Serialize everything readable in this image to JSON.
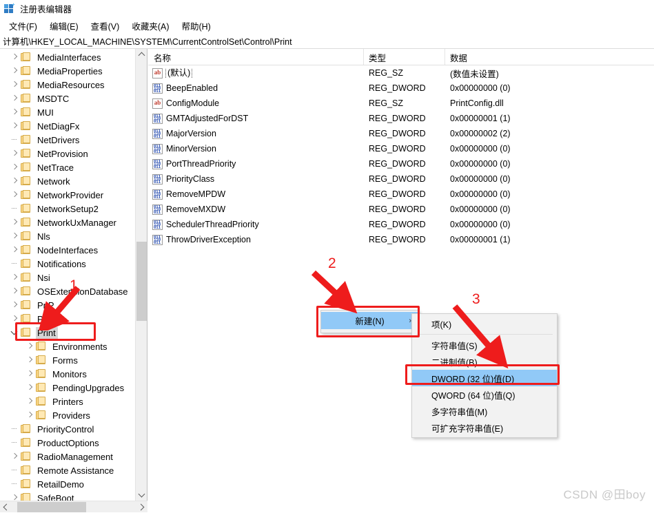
{
  "window": {
    "title": "注册表编辑器",
    "icon": "registry-editor-icon"
  },
  "menubar": {
    "items": [
      {
        "label": "文件(F)"
      },
      {
        "label": "编辑(E)"
      },
      {
        "label": "查看(V)"
      },
      {
        "label": "收藏夹(A)"
      },
      {
        "label": "帮助(H)"
      }
    ]
  },
  "address": {
    "path": "计算机\\HKEY_LOCAL_MACHINE\\SYSTEM\\CurrentControlSet\\Control\\Print"
  },
  "tree": {
    "items": [
      {
        "label": "MediaInterfaces",
        "depth": 1,
        "state": "collapsed",
        "selected": false
      },
      {
        "label": "MediaProperties",
        "depth": 1,
        "state": "collapsed",
        "selected": false
      },
      {
        "label": "MediaResources",
        "depth": 1,
        "state": "collapsed",
        "selected": false
      },
      {
        "label": "MSDTC",
        "depth": 1,
        "state": "collapsed",
        "selected": false
      },
      {
        "label": "MUI",
        "depth": 1,
        "state": "collapsed",
        "selected": false
      },
      {
        "label": "NetDiagFx",
        "depth": 1,
        "state": "collapsed",
        "selected": false
      },
      {
        "label": "NetDrivers",
        "depth": 1,
        "state": "leaf",
        "selected": false
      },
      {
        "label": "NetProvision",
        "depth": 1,
        "state": "collapsed",
        "selected": false
      },
      {
        "label": "NetTrace",
        "depth": 1,
        "state": "collapsed",
        "selected": false
      },
      {
        "label": "Network",
        "depth": 1,
        "state": "collapsed",
        "selected": false
      },
      {
        "label": "NetworkProvider",
        "depth": 1,
        "state": "collapsed",
        "selected": false
      },
      {
        "label": "NetworkSetup2",
        "depth": 1,
        "state": "leaf",
        "selected": false
      },
      {
        "label": "NetworkUxManager",
        "depth": 1,
        "state": "collapsed",
        "selected": false
      },
      {
        "label": "Nls",
        "depth": 1,
        "state": "collapsed",
        "selected": false
      },
      {
        "label": "NodeInterfaces",
        "depth": 1,
        "state": "collapsed",
        "selected": false
      },
      {
        "label": "Notifications",
        "depth": 1,
        "state": "leaf",
        "selected": false
      },
      {
        "label": "Nsi",
        "depth": 1,
        "state": "collapsed",
        "selected": false
      },
      {
        "label": "OSExtensionDatabase",
        "depth": 1,
        "state": "collapsed",
        "selected": false
      },
      {
        "label": "PnP",
        "depth": 1,
        "state": "collapsed",
        "selected": false
      },
      {
        "label": "Power",
        "depth": 1,
        "state": "collapsed",
        "selected": false
      },
      {
        "label": "Print",
        "depth": 1,
        "state": "expanded",
        "selected": true
      },
      {
        "label": "Environments",
        "depth": 2,
        "state": "collapsed",
        "selected": false
      },
      {
        "label": "Forms",
        "depth": 2,
        "state": "collapsed",
        "selected": false
      },
      {
        "label": "Monitors",
        "depth": 2,
        "state": "collapsed",
        "selected": false
      },
      {
        "label": "PendingUpgrades",
        "depth": 2,
        "state": "collapsed",
        "selected": false
      },
      {
        "label": "Printers",
        "depth": 2,
        "state": "collapsed",
        "selected": false
      },
      {
        "label": "Providers",
        "depth": 2,
        "state": "collapsed",
        "selected": false
      },
      {
        "label": "PriorityControl",
        "depth": 1,
        "state": "leaf",
        "selected": false
      },
      {
        "label": "ProductOptions",
        "depth": 1,
        "state": "leaf",
        "selected": false
      },
      {
        "label": "RadioManagement",
        "depth": 1,
        "state": "collapsed",
        "selected": false
      },
      {
        "label": "Remote Assistance",
        "depth": 1,
        "state": "leaf",
        "selected": false
      },
      {
        "label": "RetailDemo",
        "depth": 1,
        "state": "leaf",
        "selected": false
      },
      {
        "label": "SafeBoot",
        "depth": 1,
        "state": "collapsed",
        "selected": false
      }
    ]
  },
  "list": {
    "columns": [
      {
        "label": "名称"
      },
      {
        "label": "类型"
      },
      {
        "label": "数据"
      }
    ],
    "rows": [
      {
        "name": "(默认)",
        "icon": "string-value-icon",
        "type": "REG_SZ",
        "data": "(数值未设置)",
        "focused": true
      },
      {
        "name": "BeepEnabled",
        "icon": "dword-value-icon",
        "type": "REG_DWORD",
        "data": "0x00000000 (0)",
        "focused": false
      },
      {
        "name": "ConfigModule",
        "icon": "string-value-icon",
        "type": "REG_SZ",
        "data": "PrintConfig.dll",
        "focused": false
      },
      {
        "name": "GMTAdjustedForDST",
        "icon": "dword-value-icon",
        "type": "REG_DWORD",
        "data": "0x00000001 (1)",
        "focused": false
      },
      {
        "name": "MajorVersion",
        "icon": "dword-value-icon",
        "type": "REG_DWORD",
        "data": "0x00000002 (2)",
        "focused": false
      },
      {
        "name": "MinorVersion",
        "icon": "dword-value-icon",
        "type": "REG_DWORD",
        "data": "0x00000000 (0)",
        "focused": false
      },
      {
        "name": "PortThreadPriority",
        "icon": "dword-value-icon",
        "type": "REG_DWORD",
        "data": "0x00000000 (0)",
        "focused": false
      },
      {
        "name": "PriorityClass",
        "icon": "dword-value-icon",
        "type": "REG_DWORD",
        "data": "0x00000000 (0)",
        "focused": false
      },
      {
        "name": "RemoveMPDW",
        "icon": "dword-value-icon",
        "type": "REG_DWORD",
        "data": "0x00000000 (0)",
        "focused": false
      },
      {
        "name": "RemoveMXDW",
        "icon": "dword-value-icon",
        "type": "REG_DWORD",
        "data": "0x00000000 (0)",
        "focused": false
      },
      {
        "name": "SchedulerThreadPriority",
        "icon": "dword-value-icon",
        "type": "REG_DWORD",
        "data": "0x00000000 (0)",
        "focused": false
      },
      {
        "name": "ThrowDriverException",
        "icon": "dword-value-icon",
        "type": "REG_DWORD",
        "data": "0x00000001 (1)",
        "focused": false
      }
    ]
  },
  "context_menu": {
    "new_item": {
      "label": "新建(N)",
      "arrow": "›",
      "highlighted": true
    },
    "submenu": [
      {
        "label": "项(K)",
        "highlighted": false,
        "separator_after": true
      },
      {
        "label": "字符串值(S)",
        "highlighted": false,
        "separator_after": false
      },
      {
        "label": "二进制值(B)",
        "highlighted": false,
        "separator_after": false
      },
      {
        "label": "DWORD (32 位)值(D)",
        "highlighted": true,
        "separator_after": false
      },
      {
        "label": "QWORD (64 位)值(Q)",
        "highlighted": false,
        "separator_after": false
      },
      {
        "label": "多字符串值(M)",
        "highlighted": false,
        "separator_after": false
      },
      {
        "label": "可扩充字符串值(E)",
        "highlighted": false,
        "separator_after": false
      }
    ]
  },
  "annotations": {
    "color": "#ee1c1c",
    "steps": [
      {
        "number": "1",
        "target": "tree-item-print"
      },
      {
        "number": "2",
        "target": "context-menu-new"
      },
      {
        "number": "3",
        "target": "context-menu-dword-32"
      }
    ]
  },
  "watermark": {
    "text": "CSDN @田boy"
  }
}
